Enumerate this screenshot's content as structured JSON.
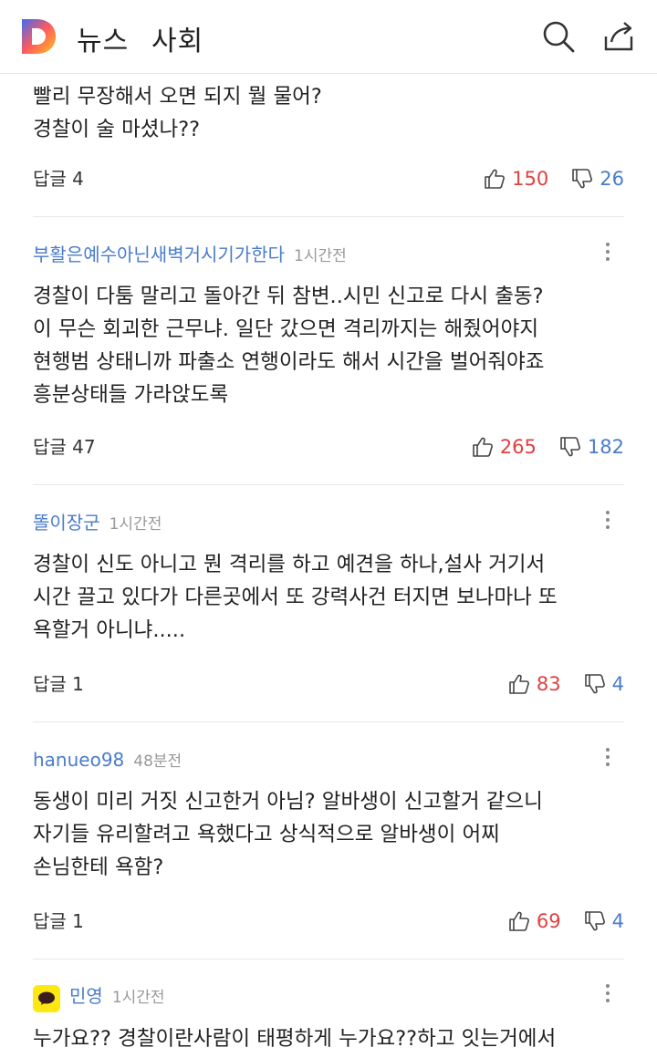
{
  "header": {
    "logo_letter": "D",
    "news_label": "뉴스",
    "section_label": "사회",
    "search_icon": "search-icon",
    "share_icon": "share-icon"
  },
  "partial_comment": {
    "lines": [
      "빨리 무장해서 오면 되지 뭘 물어?",
      "경찰이 술 마셨나??"
    ],
    "reply_label": "답글 4",
    "likes": "150",
    "dislikes": "26"
  },
  "comments": [
    {
      "author": "부활은예수아닌새벽거시기가한다",
      "time": "1시간전",
      "lines": [
        "경찰이 다툼 말리고 돌아간 뒤 참변..시민 신고로 다시 출동?",
        "이 무슨 회괴한 근무냐. 일단 갔으면 격리까지는 해줬어야지",
        "현행범 상태니까 파출소 연행이라도 해서 시간을 벌어줘야죠",
        "흥분상태들 가라앉도록"
      ],
      "reply_label": "답글 47",
      "likes": "265",
      "dislikes": "182"
    },
    {
      "author": "똘이장군",
      "time": "1시간전",
      "lines": [
        "경찰이 신도 아니고 뭔 격리를 하고 예견을 하나,설사 거기서",
        "시간 끌고 있다가 다른곳에서 또 강력사건 터지면 보나마나 또",
        "욕할거 아니냐....."
      ],
      "reply_label": "답글 1",
      "likes": "83",
      "dislikes": "4"
    },
    {
      "author": "hanueo98",
      "time": "48분전",
      "lines": [
        "동생이 미리 거짓 신고한거 아님? 알바생이 신고할거 같으니",
        "자기들 유리할려고 욕했다고  상식적으로 알바생이 어찌",
        "손님한테 욕함?"
      ],
      "reply_label": "답글 1",
      "likes": "69",
      "dislikes": "4"
    },
    {
      "author": "민영",
      "time": "1시간전",
      "avatar_icon": "kakao-talk-icon",
      "lines": [
        "누가요?? 경찰이란사람이 태평하게 누가요??하고 잇는거에서"
      ]
    }
  ],
  "colors": {
    "like": "#e04040",
    "dislike": "#4a7ccd",
    "author": "#4a7ccd",
    "logo_blue": "#3b6cf5",
    "logo_yellow": "#ffc21a"
  }
}
